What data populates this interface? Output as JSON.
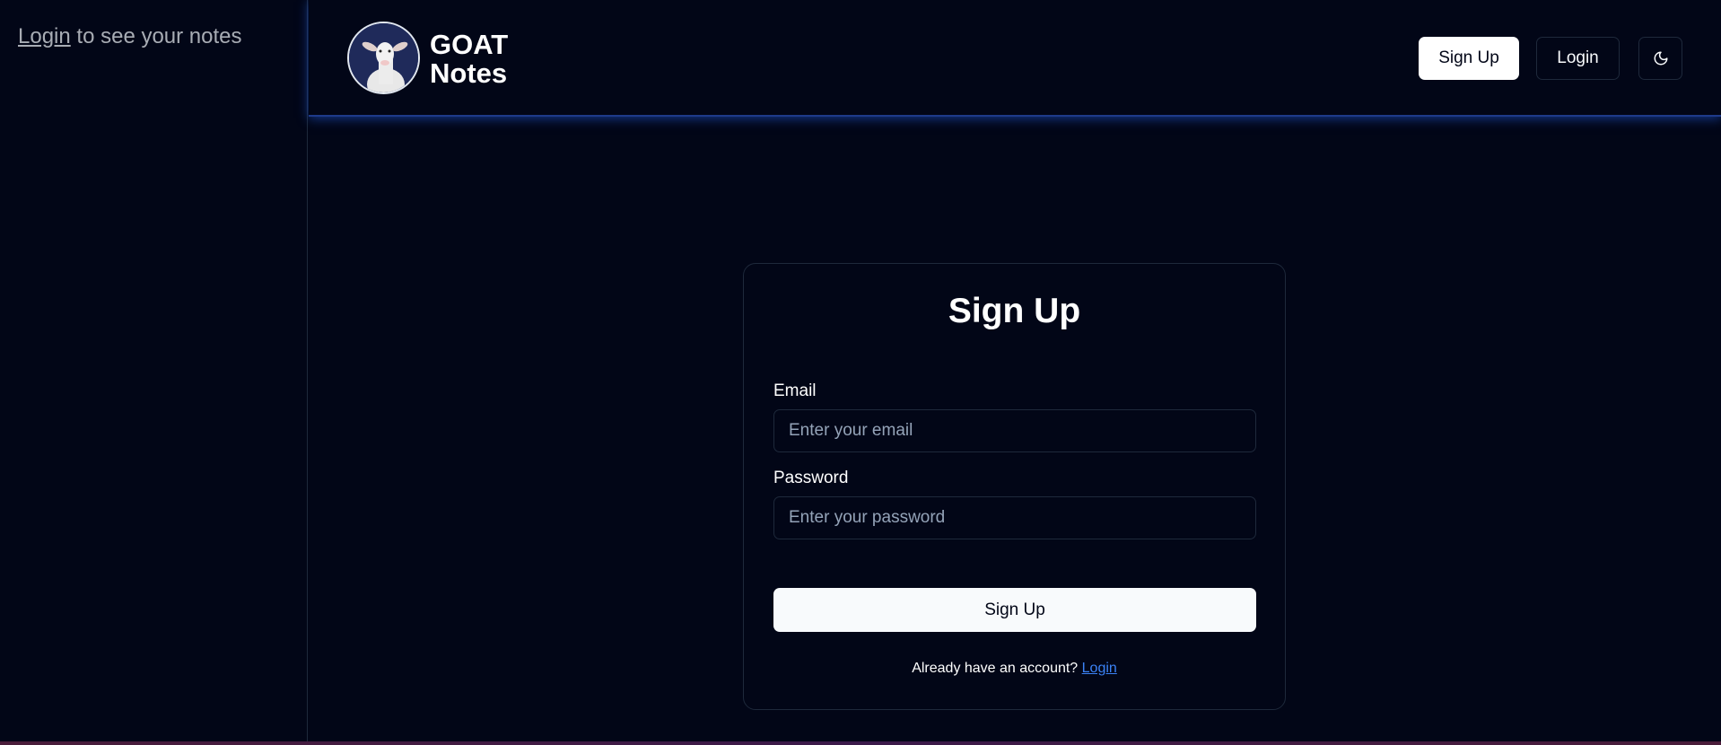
{
  "sidebar": {
    "login_link": "Login",
    "message": "to see your notes"
  },
  "header": {
    "brand_line1": "GOAT",
    "brand_line2": "Notes",
    "signup_label": "Sign Up",
    "login_label": "Login",
    "theme_icon": "moon-icon",
    "logo_icon": "goat-logo",
    "sidebar_toggle_icon": "panel-left-icon"
  },
  "form": {
    "title": "Sign Up",
    "email_label": "Email",
    "email_placeholder": "Enter your email",
    "email_value": "",
    "password_label": "Password",
    "password_placeholder": "Enter your password",
    "password_value": "",
    "submit_label": "Sign Up",
    "footer_text": "Already have an account?",
    "footer_link": "Login"
  },
  "colors": {
    "background": "#020617",
    "border": "#1e293b",
    "accent_glow": "#2563eb",
    "link": "#3b82f6"
  }
}
